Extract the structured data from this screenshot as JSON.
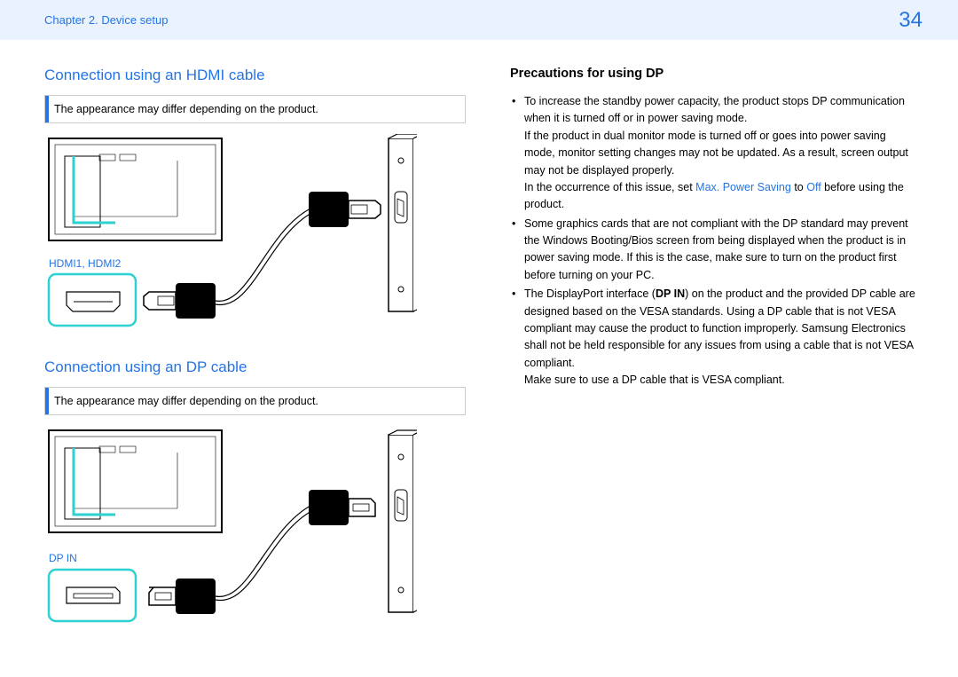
{
  "header": {
    "chapter": "Chapter 2. Device setup",
    "pageNumber": "34"
  },
  "leftColumn": {
    "hdmiSection": {
      "title": "Connection using an HDMI cable",
      "note": "The appearance may differ depending on the product.",
      "portLabel": "HDMI1, HDMI2"
    },
    "dpSection": {
      "title": "Connection using an DP cable",
      "note": "The appearance may differ depending on the product.",
      "portLabel": "DP IN"
    }
  },
  "rightColumn": {
    "title": "Precautions for using DP",
    "bullet1": {
      "text1": "To increase the standby power capacity, the product stops DP communication when it is turned off or in power saving mode.",
      "text2": "If the product in dual monitor mode is turned off or goes into power saving mode, monitor setting changes may not be updated. As a result, screen output may not be displayed properly.",
      "text3a": "In the occurrence of this issue, set ",
      "highlight1": "Max. Power Saving",
      "text3b": " to ",
      "highlight2": "Off",
      "text3c": " before using the product."
    },
    "bullet2": "Some graphics cards that are not compliant with the DP standard may prevent the Windows Booting/Bios screen from being displayed when the product is in power saving mode. If this is the case, make sure to turn on the product first before turning on your PC.",
    "bullet3": {
      "text1a": "The DisplayPort interface (",
      "bold1": "DP IN",
      "text1b": ") on the product and the provided DP cable are designed based on the VESA standards. Using a DP cable that is not VESA compliant may cause the product to function improperly. Samsung Electronics shall not be held responsible for any issues from using a cable that is not VESA compliant.",
      "text2": "Make sure to use a DP cable that is VESA compliant."
    }
  }
}
